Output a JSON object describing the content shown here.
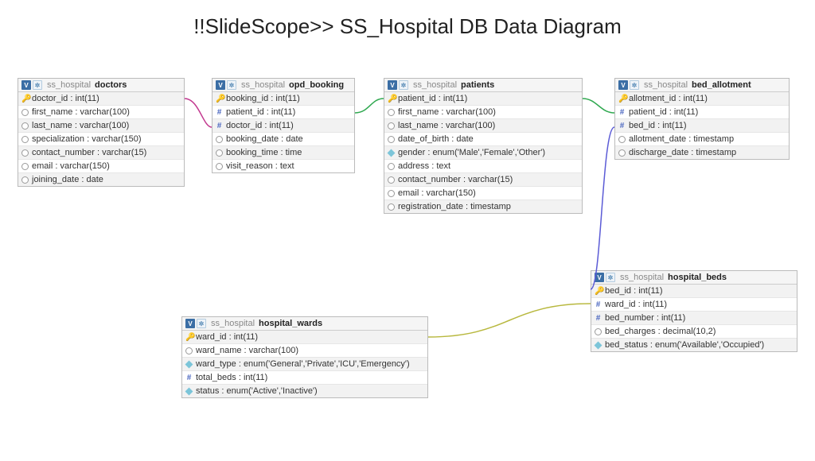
{
  "title": "!!SlideScope>> SS_Hospital DB Data Diagram",
  "schema": "ss_hospital",
  "tables": {
    "doctors": {
      "name": "doctors",
      "cols": [
        {
          "icon": "key",
          "name": "doctor_id",
          "type": "int(11)"
        },
        {
          "icon": "col",
          "name": "first_name",
          "type": "varchar(100)"
        },
        {
          "icon": "col",
          "name": "last_name",
          "type": "varchar(100)"
        },
        {
          "icon": "col",
          "name": "specialization",
          "type": "varchar(150)"
        },
        {
          "icon": "col",
          "name": "contact_number",
          "type": "varchar(15)"
        },
        {
          "icon": "col",
          "name": "email",
          "type": "varchar(150)"
        },
        {
          "icon": "col",
          "name": "joining_date",
          "type": "date"
        }
      ]
    },
    "opd_booking": {
      "name": "opd_booking",
      "cols": [
        {
          "icon": "key",
          "name": "booking_id",
          "type": "int(11)"
        },
        {
          "icon": "fk",
          "name": "patient_id",
          "type": "int(11)"
        },
        {
          "icon": "fk",
          "name": "doctor_id",
          "type": "int(11)"
        },
        {
          "icon": "col",
          "name": "booking_date",
          "type": "date"
        },
        {
          "icon": "col",
          "name": "booking_time",
          "type": "time"
        },
        {
          "icon": "col",
          "name": "visit_reason",
          "type": "text"
        }
      ]
    },
    "patients": {
      "name": "patients",
      "cols": [
        {
          "icon": "key",
          "name": "patient_id",
          "type": "int(11)"
        },
        {
          "icon": "col",
          "name": "first_name",
          "type": "varchar(100)"
        },
        {
          "icon": "col",
          "name": "last_name",
          "type": "varchar(100)"
        },
        {
          "icon": "col",
          "name": "date_of_birth",
          "type": "date"
        },
        {
          "icon": "dia",
          "name": "gender",
          "type": "enum('Male','Female','Other')"
        },
        {
          "icon": "col",
          "name": "address",
          "type": "text"
        },
        {
          "icon": "col",
          "name": "contact_number",
          "type": "varchar(15)"
        },
        {
          "icon": "col",
          "name": "email",
          "type": "varchar(150)"
        },
        {
          "icon": "col",
          "name": "registration_date",
          "type": "timestamp"
        }
      ]
    },
    "bed_allotment": {
      "name": "bed_allotment",
      "cols": [
        {
          "icon": "key",
          "name": "allotment_id",
          "type": "int(11)"
        },
        {
          "icon": "fk",
          "name": "patient_id",
          "type": "int(11)"
        },
        {
          "icon": "fk",
          "name": "bed_id",
          "type": "int(11)"
        },
        {
          "icon": "col",
          "name": "allotment_date",
          "type": "timestamp"
        },
        {
          "icon": "col",
          "name": "discharge_date",
          "type": "timestamp"
        }
      ]
    },
    "hospital_beds": {
      "name": "hospital_beds",
      "cols": [
        {
          "icon": "key",
          "name": "bed_id",
          "type": "int(11)"
        },
        {
          "icon": "fk",
          "name": "ward_id",
          "type": "int(11)"
        },
        {
          "icon": "fk",
          "name": "bed_number",
          "type": "int(11)"
        },
        {
          "icon": "col",
          "name": "bed_charges",
          "type": "decimal(10,2)"
        },
        {
          "icon": "dia",
          "name": "bed_status",
          "type": "enum('Available','Occupied')"
        }
      ]
    },
    "hospital_wards": {
      "name": "hospital_wards",
      "cols": [
        {
          "icon": "key",
          "name": "ward_id",
          "type": "int(11)"
        },
        {
          "icon": "col",
          "name": "ward_name",
          "type": "varchar(100)"
        },
        {
          "icon": "dia",
          "name": "ward_type",
          "type": "enum('General','Private','ICU','Emergency')"
        },
        {
          "icon": "fk",
          "name": "total_beds",
          "type": "int(11)"
        },
        {
          "icon": "dia",
          "name": "status",
          "type": "enum('Active','Inactive')"
        }
      ]
    }
  },
  "relations": [
    {
      "from": "doctors.doctor_id",
      "to": "opd_booking.doctor_id",
      "color": "#c2388f"
    },
    {
      "from": "opd_booking.patient_id",
      "to": "patients.patient_id",
      "color": "#2fa84f"
    },
    {
      "from": "patients.patient_id",
      "to": "bed_allotment.patient_id",
      "color": "#2fa84f"
    },
    {
      "from": "bed_allotment.bed_id",
      "to": "hospital_beds.bed_id",
      "color": "#5b5bd6"
    },
    {
      "from": "hospital_beds.ward_id",
      "to": "hospital_wards.ward_id",
      "color": "#b8b83e"
    }
  ]
}
